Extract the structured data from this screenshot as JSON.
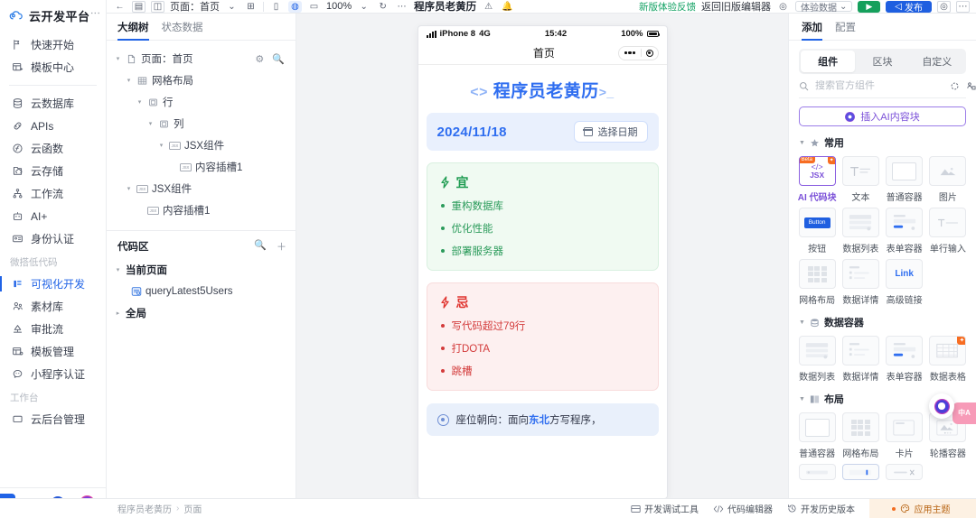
{
  "brand": {
    "name": "云开发平台",
    "logo_icon": "cloud-logo-icon",
    "more_icon": "more-vertical-icon"
  },
  "sidebar": {
    "groups": [
      {
        "label": "",
        "items": [
          {
            "label": "快速开始",
            "icon": "flag-icon",
            "active": false
          },
          {
            "label": "模板中心",
            "icon": "template-center-icon",
            "active": false
          }
        ]
      },
      {
        "label": "",
        "items": [
          {
            "label": "云数据库",
            "icon": "database-icon",
            "active": false
          },
          {
            "label": "APIs",
            "icon": "api-link-icon",
            "active": false
          },
          {
            "label": "云函数",
            "icon": "function-icon",
            "active": false
          },
          {
            "label": "云存储",
            "icon": "cloud-storage-icon",
            "active": false
          },
          {
            "label": "工作流",
            "icon": "workflow-icon",
            "active": false
          },
          {
            "label": "AI+",
            "icon": "ai-robot-icon",
            "active": false
          },
          {
            "label": "身份认证",
            "icon": "id-card-icon",
            "active": false
          }
        ]
      },
      {
        "label": "微搭低代码",
        "items": [
          {
            "label": "可视化开发",
            "icon": "visual-dev-icon",
            "active": true
          },
          {
            "label": "素材库",
            "icon": "assets-icon",
            "active": false
          },
          {
            "label": "审批流",
            "icon": "approval-icon",
            "active": false
          },
          {
            "label": "模板管理",
            "icon": "template-manage-icon",
            "active": false
          },
          {
            "label": "小程序认证",
            "icon": "miniprogram-auth-icon",
            "active": false
          }
        ]
      },
      {
        "label": "工作台",
        "items": [
          {
            "label": "云后台管理",
            "icon": "admin-console-icon",
            "active": false
          }
        ]
      }
    ],
    "bottom": {
      "collapse_icon": "chevron-left-icon",
      "avatar_icon": "user-avatar-icon",
      "ai_icon": "ai-orb-icon"
    }
  },
  "topbar": {
    "back_icon": "arrow-left-icon",
    "outline_icon": "outline-panel-icon",
    "split_icon": "split-panel-icon",
    "page_label": "页面：首页",
    "page_caret": "chevron-down-icon",
    "add_page_icon": "add-page-icon",
    "phone_icon": "phone-preview-icon",
    "tablet_icon": "tablet-preview-icon",
    "desktop_icon": "desktop-preview-icon",
    "zoom": "100%",
    "zoom_caret": "chevron-down-icon",
    "refresh_icon": "refresh-icon",
    "more_icon": "more-horizontal-icon",
    "app_title": "程序员老黄历",
    "warn_icon": "warning-circle-icon",
    "bell_icon": "notification-icon",
    "feedback_label": "新版体验反馈",
    "back_old_label": "返回旧版编辑器",
    "user_icon": "user-circle-icon",
    "experience_label": "体验数据",
    "experience_caret": "chevron-down-icon",
    "preview_icon": "play-icon",
    "publish_label": "发布",
    "publish_icon": "publish-icon",
    "settings_icon": "gear-icon",
    "overflow_icon": "more-horizontal-icon"
  },
  "outline": {
    "tabs": [
      {
        "label": "大纲树",
        "active": true
      },
      {
        "label": "状态数据",
        "active": false
      }
    ],
    "header": {
      "label": "页面：首页",
      "icon": "page-icon",
      "settings_icon": "gear-icon",
      "search_icon": "search-icon"
    },
    "nodes": [
      {
        "label": "网格布局",
        "icon": "grid-layout-icon",
        "indent": 1,
        "caret": "down"
      },
      {
        "label": "行",
        "icon": "row-icon",
        "indent": 2,
        "caret": "down"
      },
      {
        "label": "列",
        "icon": "column-icon",
        "indent": 3,
        "caret": "down"
      },
      {
        "label": "JSX组件",
        "icon": "jsx-icon",
        "indent": 4,
        "caret": "down"
      },
      {
        "label": "内容插槽1",
        "icon": "jsx-icon",
        "indent": 5,
        "caret": "none"
      },
      {
        "label": "JSX组件",
        "icon": "jsx-icon",
        "indent": 1,
        "caret": "down"
      },
      {
        "label": "内容插槽1",
        "icon": "jsx-icon",
        "indent": 2,
        "caret": "none"
      }
    ],
    "code_area": {
      "title": "代码区",
      "search_icon": "search-icon",
      "add_icon": "plus-icon",
      "nodes": [
        {
          "label": "当前页面",
          "caret": "down",
          "icon": "none",
          "indent": 0,
          "bold": true
        },
        {
          "label": "queryLatest5Users",
          "caret": "none",
          "icon": "query-icon",
          "indent": 1,
          "bold": false
        },
        {
          "label": "全局",
          "caret": "right",
          "icon": "none",
          "indent": 0,
          "bold": true
        }
      ]
    }
  },
  "preview": {
    "status": {
      "device": "iPhone 8",
      "network": "4G",
      "time": "15:42",
      "battery": "100%",
      "signal_icon": "signal-bars-icon",
      "battery_icon": "battery-icon"
    },
    "navbar": {
      "title": "首页",
      "capsule_more_icon": "capsule-more-icon",
      "capsule_target_icon": "capsule-target-icon"
    },
    "app_title": {
      "prefix": "<>",
      "text": "程序员老黄历",
      "suffix": ">_"
    },
    "date_section": {
      "date": "2024/11/18",
      "button_label": "选择日期",
      "button_icon": "calendar-icon"
    },
    "good_card": {
      "title": "宜",
      "icon": "lightning-icon",
      "items": [
        "重构数据库",
        "优化性能",
        "部署服务器"
      ]
    },
    "bad_card": {
      "title": "忌",
      "icon": "lightning-icon",
      "items": [
        "写代码超过79行",
        "打DOTA",
        "跳槽"
      ]
    },
    "tip_card": {
      "icon": "compass-icon",
      "prefix": "座位朝向：面向",
      "highlight": "东北",
      "suffix": "方写程序，"
    }
  },
  "right_panel": {
    "tabs": [
      {
        "label": "添加",
        "active": true
      },
      {
        "label": "配置",
        "active": false
      }
    ],
    "segments": [
      {
        "label": "组件",
        "active": true
      },
      {
        "label": "区块",
        "active": false
      },
      {
        "label": "自定义",
        "active": false
      }
    ],
    "search": {
      "placeholder": "搜索官方组件",
      "value": "",
      "search_icon": "search-icon",
      "refresh_icon": "circle-refresh-icon",
      "manage_icon": "component-manage-icon"
    },
    "ai_button": {
      "label": "插入AI内容块",
      "icon": "ai-orb-icon"
    },
    "sections": [
      {
        "title": "常用",
        "icon": "star-section-icon",
        "caret": "down",
        "components": [
          {
            "label": "AI 代码块",
            "thumb": "jsx-code-thumb",
            "selected": true,
            "badge": "Beta",
            "corner_badge": "ai-corner-icon"
          },
          {
            "label": "文本",
            "thumb": "text-thumb",
            "selected": false
          },
          {
            "label": "普通容器",
            "thumb": "container-thumb",
            "selected": false
          },
          {
            "label": "图片",
            "thumb": "image-thumb",
            "selected": false
          },
          {
            "label": "按钮",
            "thumb": "button-thumb",
            "selected": false
          },
          {
            "label": "数据列表",
            "thumb": "data-list-thumb",
            "selected": false
          },
          {
            "label": "表单容器",
            "thumb": "form-thumb",
            "selected": false
          },
          {
            "label": "单行输入",
            "thumb": "input-thumb",
            "selected": false
          },
          {
            "label": "网格布局",
            "thumb": "grid-thumb",
            "selected": false
          },
          {
            "label": "数据详情",
            "thumb": "detail-thumb",
            "selected": false
          },
          {
            "label": "高级链接",
            "thumb": "link-thumb",
            "selected": false
          }
        ]
      },
      {
        "title": "数据容器",
        "icon": "data-section-icon",
        "caret": "down",
        "components": [
          {
            "label": "数据列表",
            "thumb": "data-list-thumb",
            "selected": false
          },
          {
            "label": "数据详情",
            "thumb": "detail-thumb",
            "selected": false
          },
          {
            "label": "表单容器",
            "thumb": "form-thumb",
            "selected": false
          },
          {
            "label": "数据表格",
            "thumb": "table-thumb",
            "selected": false,
            "corner_badge": "ai-corner-icon"
          }
        ]
      },
      {
        "title": "布局",
        "icon": "layout-section-icon",
        "caret": "down",
        "components": [
          {
            "label": "普通容器",
            "thumb": "container-thumb",
            "selected": false
          },
          {
            "label": "网格布局",
            "thumb": "grid-thumb",
            "selected": false
          },
          {
            "label": "卡片",
            "thumb": "card-thumb",
            "selected": false
          },
          {
            "label": "轮播容器",
            "thumb": "carousel-thumb",
            "selected": false
          }
        ]
      }
    ]
  },
  "floating": {
    "ai_icon": "ai-assistant-orb-icon",
    "lang_label": "中A",
    "lang_icon": "translate-icon"
  },
  "bottom_bar": {
    "breadcrumb": {
      "app": "程序员老黄历",
      "sep": "›",
      "page": "页面"
    },
    "items": [
      {
        "label": "开发调试工具",
        "icon": "debug-tool-icon"
      },
      {
        "label": "代码编辑器",
        "icon": "code-editor-icon"
      },
      {
        "label": "开发历史版本",
        "icon": "history-icon"
      }
    ],
    "theme": {
      "label": "应用主题",
      "icon": "palette-icon",
      "dot": true
    }
  },
  "colors": {
    "accent": "#2063e6",
    "good": "#2b9b5b",
    "bad": "#d33b3b",
    "ai": "#7a4fd8",
    "theme_bg": "#fdf1e3"
  }
}
